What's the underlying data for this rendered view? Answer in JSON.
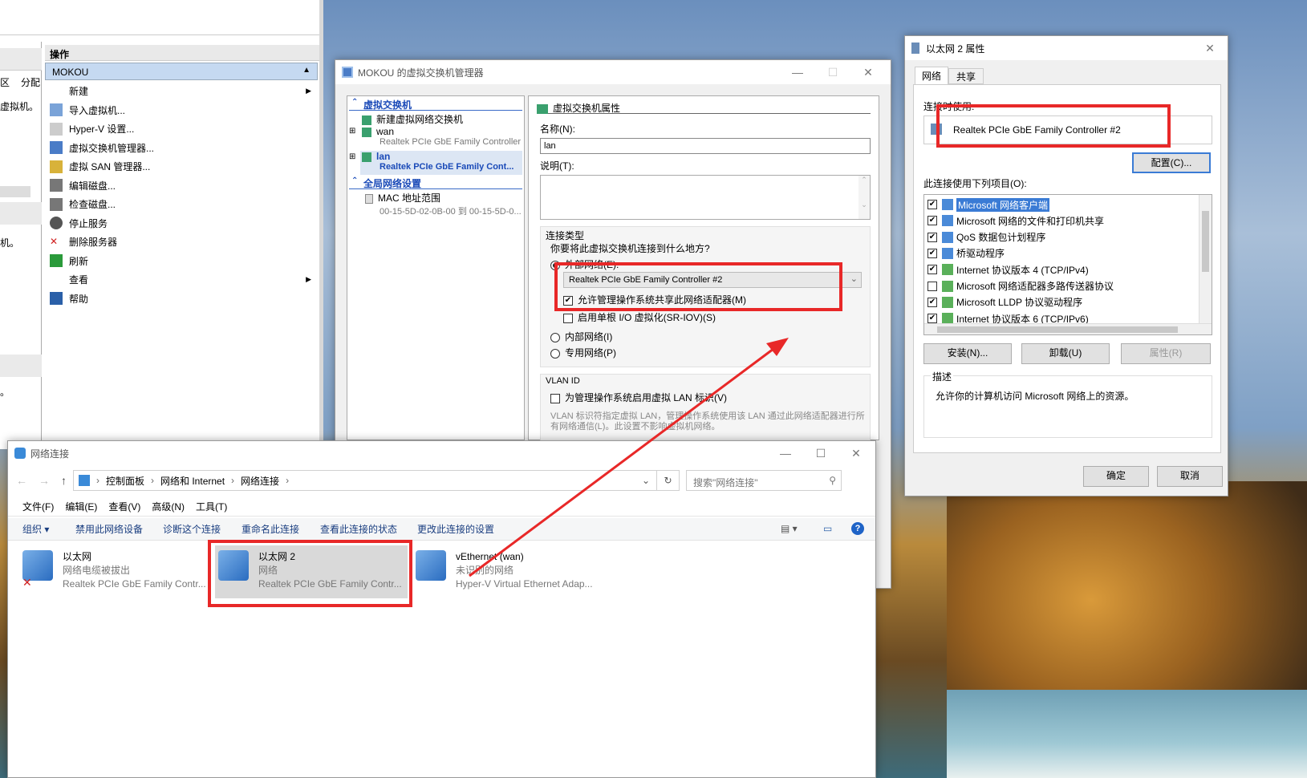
{
  "colors": {
    "accent": "#3a6bc7",
    "red": "#e82828",
    "selection": "#cde3f7"
  },
  "hyperv": {
    "actions_header": "操作",
    "server_header": "MOKOU",
    "left_col1": "区",
    "left_col2": "分配",
    "left_text1": "虚拟机。",
    "left_text2": "机。",
    "left_text3": "。",
    "menu": [
      {
        "label": "新建",
        "icon": "blank-icon"
      },
      {
        "label": "导入虚拟机...",
        "icon": "import-icon"
      },
      {
        "label": "Hyper-V 设置...",
        "icon": "settings-page-icon"
      },
      {
        "label": "虚拟交换机管理器...",
        "icon": "switch-manager-icon"
      },
      {
        "label": "虚拟 SAN 管理器...",
        "icon": "san-icon"
      },
      {
        "label": "编辑磁盘...",
        "icon": "edit-disk-icon"
      },
      {
        "label": "检查磁盘...",
        "icon": "inspect-disk-icon"
      },
      {
        "label": "停止服务",
        "icon": "stop-icon"
      },
      {
        "label": "删除服务器",
        "icon": "delete-x-icon"
      },
      {
        "label": "刷新",
        "icon": "refresh-icon"
      },
      {
        "label": "查看",
        "icon": "blank-icon"
      },
      {
        "label": "帮助",
        "icon": "help-icon"
      }
    ]
  },
  "switchmgr": {
    "title": "MOKOU 的虚拟交换机管理器",
    "tree": {
      "section1": "虚拟交换机",
      "new_switch": "新建虚拟网络交换机",
      "wan_name": "wan",
      "wan_sub": "Realtek PCIe GbE Family Controller",
      "lan_name": "lan",
      "lan_sub": "Realtek PCIe GbE Family Cont...",
      "section2": "全局网络设置",
      "mac_name": "MAC 地址范围",
      "mac_sub": "00-15-5D-02-0B-00 到 00-15-5D-0..."
    },
    "props": {
      "header": "虚拟交换机属性",
      "name_label": "名称(N):",
      "name_value": "lan",
      "desc_label": "说明(T):",
      "conn_type_label": "连接类型",
      "conn_question": "你要将此虚拟交换机连接到什么地方?",
      "external": "外部网络(E):",
      "adapter": "Realtek PCIe GbE Family Controller #2",
      "allow_share": "允许管理操作系统共享此网络适配器(M)",
      "sriov": "启用单根 I/O 虚拟化(SR-IOV)(S)",
      "internal": "内部网络(I)",
      "private": "专用网络(P)",
      "vlan_label": "VLAN ID",
      "vlan_enable": "为管理操作系统启用虚拟 LAN 标识(V)",
      "vlan_desc": "VLAN 标识符指定虚拟 LAN，管理操作系统使用该 LAN 通过此网络适配器进行所有网络通信(L)。此设置不影响虚拟机网络。"
    }
  },
  "netconn": {
    "title": "网络连接",
    "breadcrumb": [
      "控制面板",
      "网络和 Internet",
      "网络连接"
    ],
    "search_placeholder": "搜索\"网络连接\"",
    "menus": [
      "文件(F)",
      "编辑(E)",
      "查看(V)",
      "高级(N)",
      "工具(T)"
    ],
    "toolbar": [
      "组织 ▾",
      "禁用此网络设备",
      "诊断这个连接",
      "重命名此连接",
      "查看此连接的状态",
      "更改此连接的设置"
    ],
    "adapters": [
      {
        "name": "以太网",
        "status": "网络电缆被拔出",
        "device": "Realtek PCIe GbE Family Contr..."
      },
      {
        "name": "以太网 2",
        "status": "网络",
        "device": "Realtek PCIe GbE Family Contr..."
      },
      {
        "name": "vEthernet (wan)",
        "status": "未识别的网络",
        "device": "Hyper-V Virtual Ethernet Adap..."
      }
    ]
  },
  "ethprops": {
    "title": "以太网 2 属性",
    "tabs": [
      "网络",
      "共享"
    ],
    "connect_using": "连接时使用:",
    "adapter": "Realtek PCIe GbE Family Controller #2",
    "configure": "配置(C)...",
    "items_label": "此连接使用下列项目(O):",
    "items": [
      {
        "label": "Microsoft 网络客户端",
        "checked": "✔"
      },
      {
        "label": "Microsoft 网络的文件和打印机共享",
        "checked": "✔"
      },
      {
        "label": "QoS 数据包计划程序",
        "checked": "✔"
      },
      {
        "label": "桥驱动程序",
        "checked": "✔"
      },
      {
        "label": "Internet 协议版本 4 (TCP/IPv4)",
        "checked": "✔"
      },
      {
        "label": "Microsoft 网络适配器多路传送器协议",
        "checked": ""
      },
      {
        "label": "Microsoft LLDP 协议驱动程序",
        "checked": "✔"
      },
      {
        "label": "Internet 协议版本 6 (TCP/IPv6)",
        "checked": "✔"
      }
    ],
    "install": "安装(N)...",
    "uninstall": "卸载(U)",
    "properties": "属性(R)",
    "desc_label": "描述",
    "desc_text": "允许你的计算机访问 Microsoft 网络上的资源。",
    "ok": "确定",
    "cancel": "取消"
  }
}
